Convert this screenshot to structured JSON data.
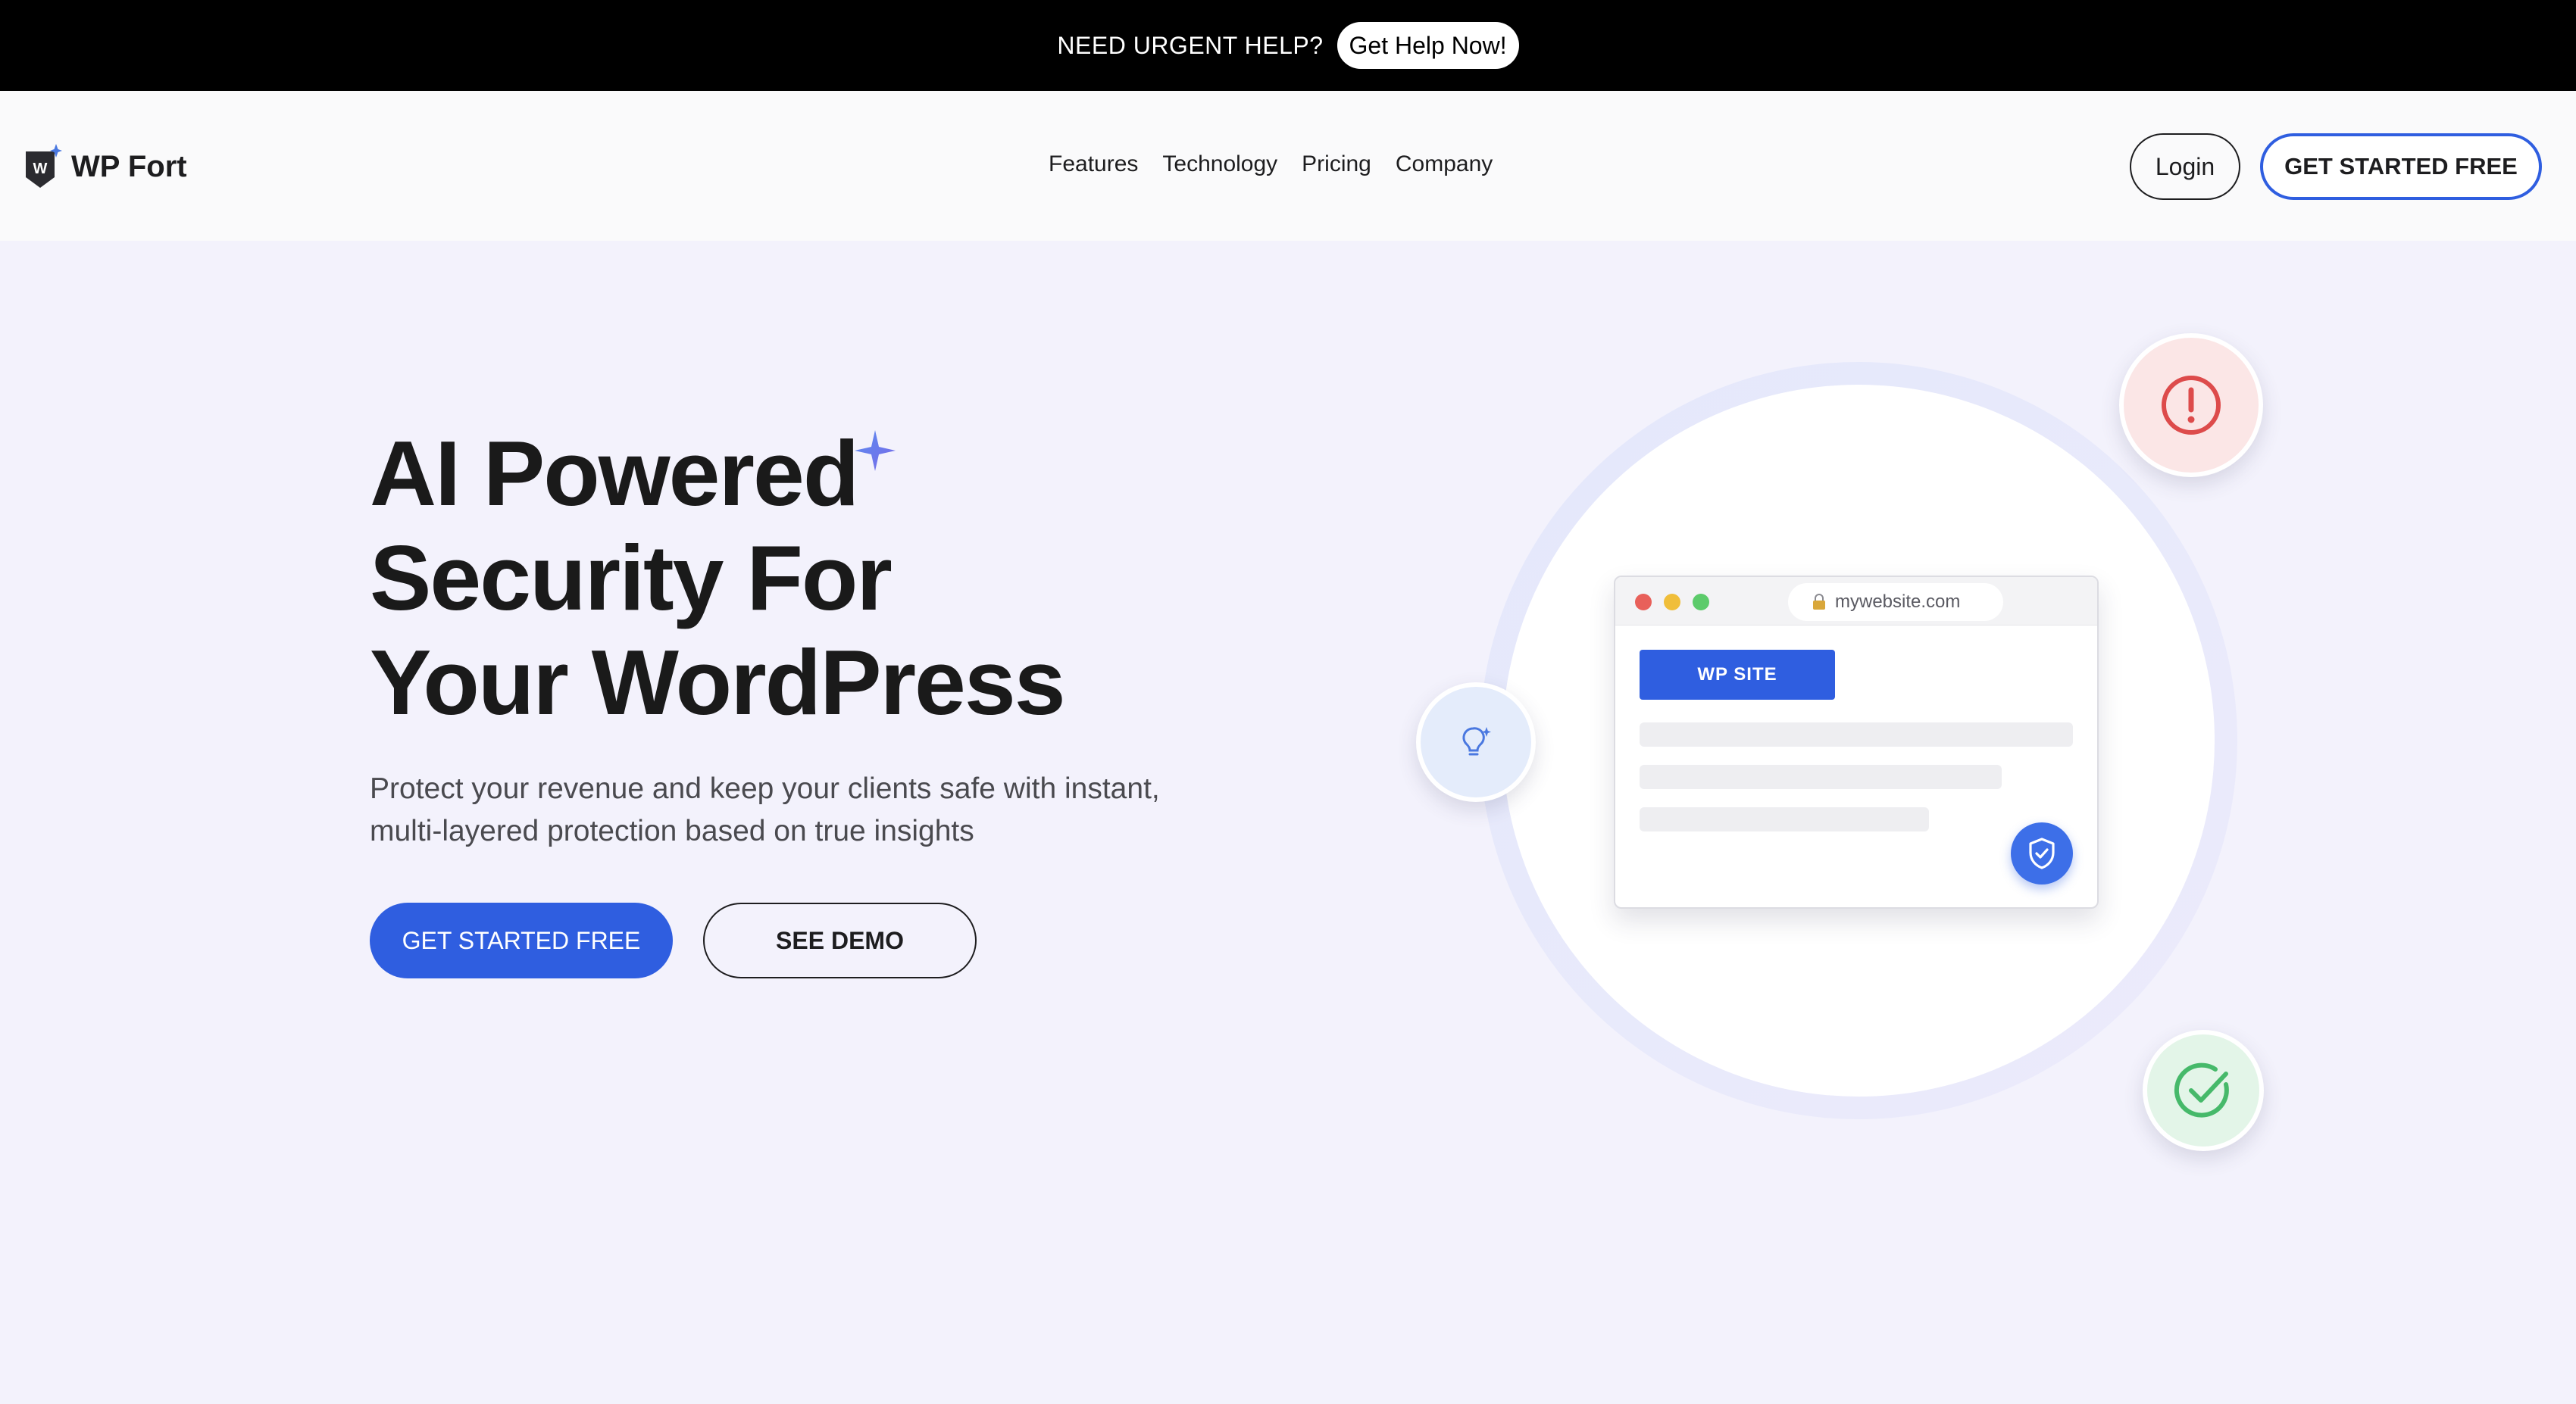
{
  "topbar": {
    "text": "NEED URGENT HELP?",
    "button": "Get Help Now!"
  },
  "header": {
    "logo_text": "WP Fort",
    "logo_mark_letter": "W",
    "nav": [
      "Features",
      "Technology",
      "Pricing",
      "Company"
    ],
    "login": "Login",
    "cta": "GET STARTED FREE"
  },
  "hero": {
    "title_lines": [
      "AI Powered",
      "Security For",
      "Your WordPress"
    ],
    "subtitle_lines": [
      "Protect your revenue and keep your clients safe with instant,",
      "multi-layered protection based on true insights"
    ],
    "primary_button": "GET STARTED FREE",
    "secondary_button": "SEE DEMO"
  },
  "illustration": {
    "url": "mywebsite.com",
    "site_label": "WP SITE",
    "icons": [
      "alert-icon",
      "lightbulb-icon",
      "check-icon",
      "shield-check-icon",
      "lock-icon",
      "sparkle-icon"
    ]
  },
  "colors": {
    "accent": "#2f5ee0",
    "background": "#f3f2fc",
    "alert": "#dd4b4b",
    "success": "#46b96a",
    "info": "#4a78e0"
  }
}
